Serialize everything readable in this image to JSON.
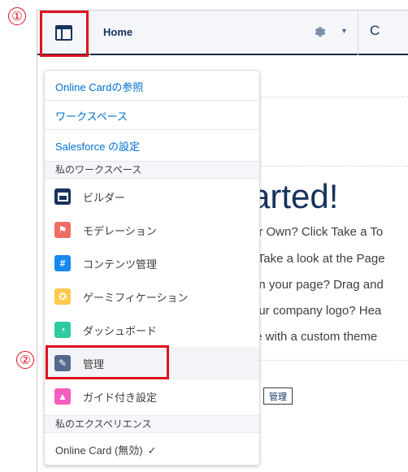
{
  "header": {
    "page_name": "Home"
  },
  "callouts": {
    "first": "①",
    "second": "②",
    "color": "#e0101c"
  },
  "canvas": {
    "hero": "arted!",
    "lines": [
      "ur Own? Click Take a To",
      "' Take a look at the Page",
      "on your page? Drag and",
      "our company logo? Hea",
      "te with a custom theme"
    ],
    "admin_chip": "管理"
  },
  "menu": {
    "links": [
      "Online Cardの参照",
      "ワークスペース",
      "Salesforce の設定"
    ],
    "section_workspaces": "私のワークスペース",
    "items": [
      {
        "label": "ビルダー",
        "icon": "builder-icon",
        "color": "#16325c"
      },
      {
        "label": "モデレーション",
        "icon": "flag-icon",
        "color": "#ef6e64"
      },
      {
        "label": "コンテンツ管理",
        "icon": "hash-icon",
        "color": "#1589ee"
      },
      {
        "label": "ゲーミフィケーション",
        "icon": "award-icon",
        "color": "#ffc94d"
      },
      {
        "label": "ダッシュボード",
        "icon": "dashboard-icon",
        "color": "#2ecb9e"
      },
      {
        "label": "管理",
        "icon": "wrench-icon",
        "color": "#54698d"
      },
      {
        "label": "ガイド付き設定",
        "icon": "rocket-icon",
        "color": "#f45ebf"
      }
    ],
    "section_experiences": "私のエクスペリエンス",
    "experience": "Online Card (無効)",
    "accent": "#0070d2"
  }
}
